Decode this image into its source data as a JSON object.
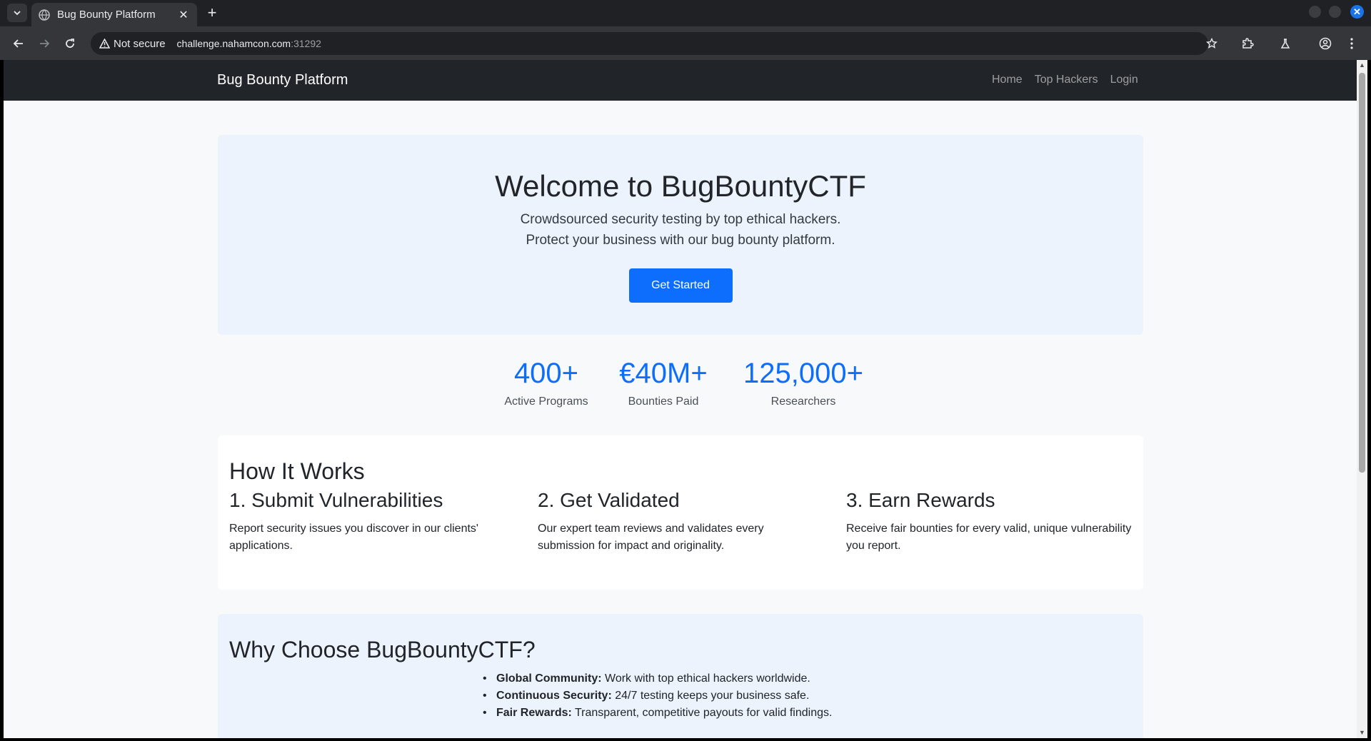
{
  "browser": {
    "tab_title": "Bug Bounty Platform",
    "security_label": "Not secure",
    "url_host": "challenge.nahamcon.com",
    "url_port": ":31292"
  },
  "navbar": {
    "brand": "Bug Bounty Platform",
    "links": [
      "Home",
      "Top Hackers",
      "Login"
    ]
  },
  "hero": {
    "title": "Welcome to BugBountyCTF",
    "line1": "Crowdsourced security testing by top ethical hackers.",
    "line2": "Protect your business with our bug bounty platform.",
    "cta": "Get Started"
  },
  "stats": [
    {
      "value": "400+",
      "label": "Active Programs"
    },
    {
      "value": "€40M+",
      "label": "Bounties Paid"
    },
    {
      "value": "125,000+",
      "label": "Researchers"
    }
  ],
  "how": {
    "title": "How It Works",
    "steps": [
      {
        "title": "1. Submit Vulnerabilities",
        "text": "Report security issues you discover in our clients' applications."
      },
      {
        "title": "2. Get Validated",
        "text": "Our expert team reviews and validates every submission for impact and originality."
      },
      {
        "title": "3. Earn Rewards",
        "text": "Receive fair bounties for every valid, unique vulnerability you report."
      }
    ]
  },
  "why": {
    "title": "Why Choose BugBountyCTF?",
    "items": [
      {
        "bold": "Global Community:",
        "text": " Work with top ethical hackers worldwide."
      },
      {
        "bold": "Continuous Security:",
        "text": " 24/7 testing keeps your business safe."
      },
      {
        "bold": "Fair Rewards:",
        "text": " Transparent, competitive payouts for valid findings."
      }
    ]
  },
  "colors": {
    "primary": "#0d6efd",
    "navbar": "#212529",
    "hero_bg": "#edf3fd"
  }
}
